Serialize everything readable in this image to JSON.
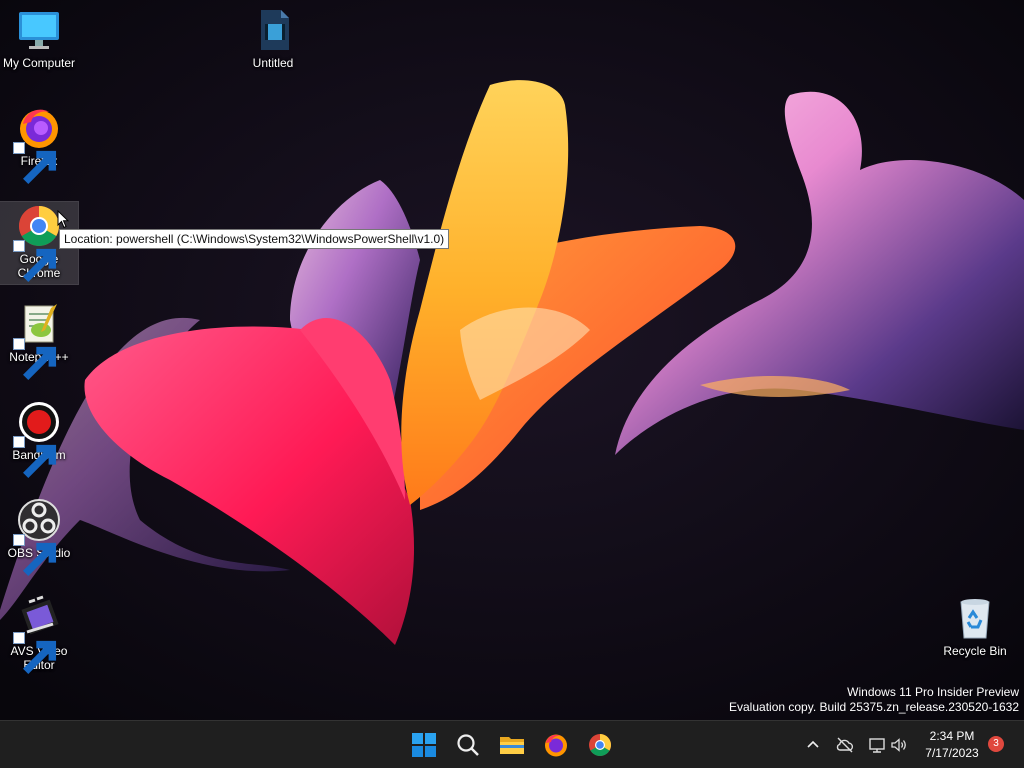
{
  "desktop": {
    "icons": [
      {
        "label": "My Computer",
        "icon": "monitor-icon"
      },
      {
        "label": "Untitled",
        "icon": "video-file-icon"
      },
      {
        "label": "Firefox",
        "icon": "firefox-icon"
      },
      {
        "label": "Google\nChrome",
        "icon": "chrome-icon"
      },
      {
        "label": "Notepad++",
        "icon": "notepadpp-icon"
      },
      {
        "label": "Bandicam",
        "icon": "bandicam-icon"
      },
      {
        "label": "OBS Studio",
        "icon": "obs-icon"
      },
      {
        "label": "AVS Video\nEditor",
        "icon": "avs-video-editor-icon"
      },
      {
        "label": "Recycle Bin",
        "icon": "recycle-bin-icon"
      }
    ],
    "tooltip": "Location: powershell (C:\\Windows\\System32\\WindowsPowerShell\\v1.0)",
    "watermark": {
      "line1": "Windows 11 Pro Insider Preview",
      "line2": "Evaluation copy. Build 25375.zn_release.230520-1632"
    }
  },
  "taskbar": {
    "apps": [
      "start-icon",
      "search-icon",
      "file-explorer-icon",
      "firefox-icon",
      "chrome-icon"
    ],
    "tray": [
      "chevron-up-icon",
      "cloud-offline-icon",
      "network-icon",
      "volume-icon"
    ],
    "time": "2:34 PM",
    "date": "7/17/2023",
    "notifications": "3"
  },
  "colors": {
    "taskbar_bg": "#1f1f1f",
    "windows_blue": "#0078d4",
    "badge": "#e0483e"
  }
}
